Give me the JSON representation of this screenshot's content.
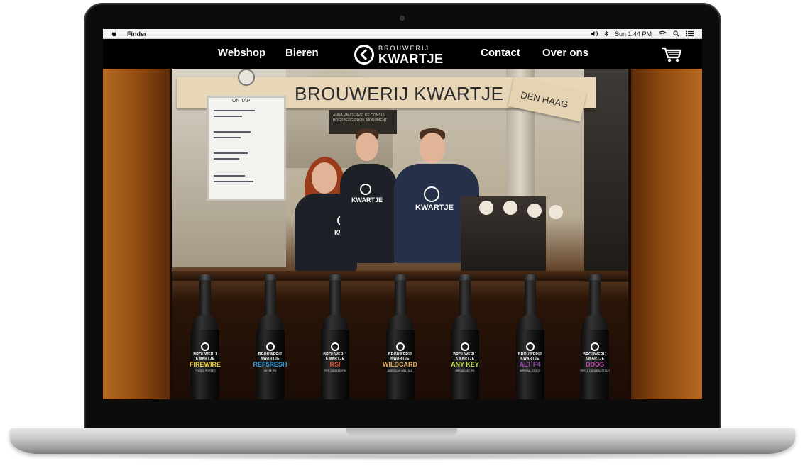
{
  "menubar": {
    "app_name": "Finder",
    "clock": "Sun 1:44 PM"
  },
  "nav": {
    "links": [
      "Webshop",
      "Bieren",
      "Contact",
      "Over ons"
    ],
    "logo_top": "BROUWERIJ",
    "logo_bottom": "KWARTJE"
  },
  "hero": {
    "banner_text": "BROUWERIJ KWARTJE",
    "sign_text": "DEN HAAG",
    "board_title": "ON TAP",
    "plaque_text": "ANNA VANDERVELDE CONSUL HOGSBERG PROV. MONUMENT",
    "shirt_top": "BROUWERIJ",
    "shirt_bottom": "KWARTJE"
  },
  "bottles": [
    {
      "brand": "BROUWERIJ KWARTJE",
      "name": "FIREWIRE",
      "style": "PEATED PORTER",
      "color": "#f0d030"
    },
    {
      "brand": "BROUWERIJ KWARTJE",
      "name": "REF5RESH",
      "style": "WHITE IPA",
      "color": "#3aa0e0"
    },
    {
      "brand": "BROUWERIJ KWARTJE",
      "name": "RSI",
      "style": "RYE SMOKED IPA",
      "color": "#e05030"
    },
    {
      "brand": "BROUWERIJ KWARTJE",
      "name": "WILDCARD",
      "style": "AMERICAN WILD ALE",
      "color": "#e8b060"
    },
    {
      "brand": "BROUWERIJ KWARTJE",
      "name": "ANY KEY",
      "style": "BREAKFAST IPA",
      "color": "#c8e040"
    },
    {
      "brand": "BROUWERIJ KWARTJE",
      "name": "ALT F4",
      "style": "IMPERIAL STOUT",
      "color": "#9a4ab0"
    },
    {
      "brand": "BROUWERIJ KWARTJE",
      "name": "DDOS",
      "style": "TRIPLE OATMEAL STOUT",
      "color": "#c050b0"
    }
  ]
}
